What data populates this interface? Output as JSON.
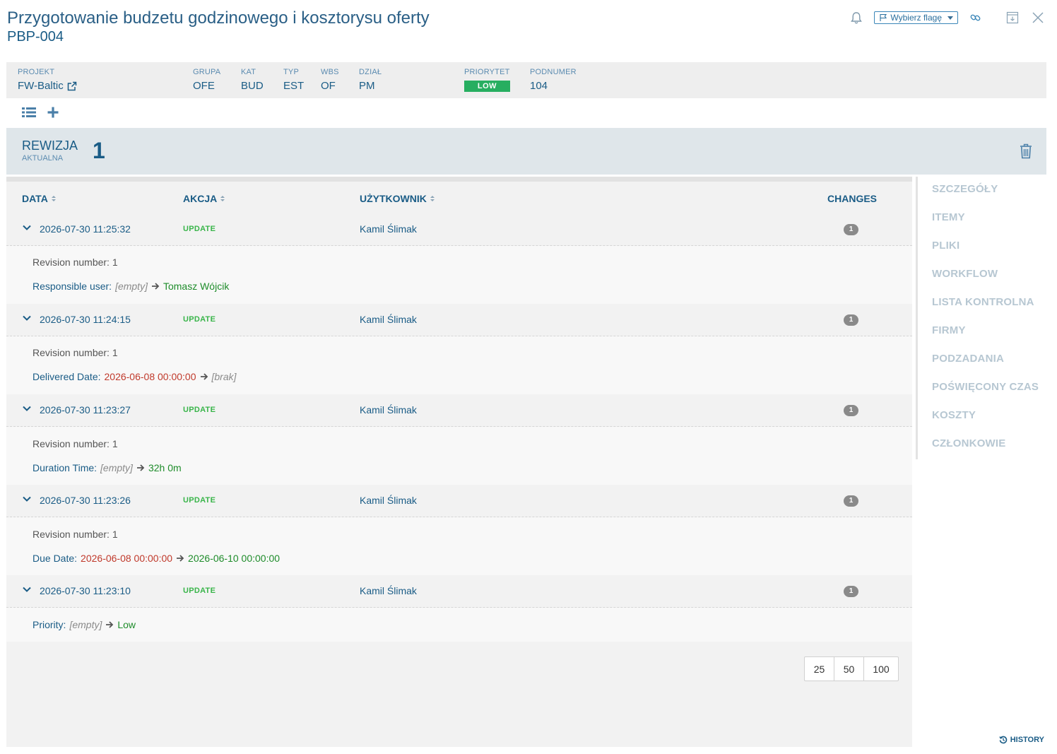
{
  "header": {
    "title": "Przygotowanie budzetu godzinowego i kosztorysu oferty",
    "code": "PBP-004",
    "flag_select": "Wybierz flagę",
    "icons": [
      "bell-icon",
      "flag-icon",
      "link-icon",
      "archive-icon",
      "close-icon"
    ]
  },
  "meta": {
    "project": {
      "label": "PROJEKT",
      "value": "FW-Baltic"
    },
    "group": {
      "label": "GRUPA",
      "value": "OFE"
    },
    "kat": {
      "label": "KAT",
      "value": "BUD"
    },
    "typ": {
      "label": "TYP",
      "value": "EST"
    },
    "wbs": {
      "label": "WBS",
      "value": "OF"
    },
    "dzial": {
      "label": "DZIAŁ",
      "value": "PM"
    },
    "priority": {
      "label": "PRIORYTET",
      "value": "LOW",
      "color": "#27ae60"
    },
    "subnumber": {
      "label": "PODNUMER",
      "value": "104"
    }
  },
  "revision": {
    "label": "REWIZJA",
    "sub": "AKTUALNA",
    "number": "1"
  },
  "table": {
    "columns": {
      "date": "DATA",
      "action": "AKCJA",
      "user": "UŻYTKOWNIK",
      "changes": "CHANGES"
    },
    "entries": [
      {
        "date": "2026-07-30 11:25:32",
        "action": "UPDATE",
        "user": "Kamil Ślimak",
        "changes": "1",
        "revision_line": "Revision number: 1",
        "field": "Responsible user:",
        "old": "[empty]",
        "new": "Tomasz Wójcik"
      },
      {
        "date": "2026-07-30 11:24:15",
        "action": "UPDATE",
        "user": "Kamil Ślimak",
        "changes": "1",
        "revision_line": "Revision number: 1",
        "field": "Delivered Date:",
        "old": "2026-06-08 00:00:00",
        "new": "[brak]"
      },
      {
        "date": "2026-07-30 11:23:27",
        "action": "UPDATE",
        "user": "Kamil Ślimak",
        "changes": "1",
        "revision_line": "Revision number: 1",
        "field": "Duration Time:",
        "old": "[empty]",
        "new": "32h 0m"
      },
      {
        "date": "2026-07-30 11:23:26",
        "action": "UPDATE",
        "user": "Kamil Ślimak",
        "changes": "1",
        "revision_line": "Revision number: 1",
        "field": "Due Date:",
        "old": "2026-06-08 00:00:00",
        "new": "2026-06-10 00:00:00"
      },
      {
        "date": "2026-07-30 11:23:10",
        "action": "UPDATE",
        "user": "Kamil Ślimak",
        "changes": "1",
        "field": "Priority:",
        "old": "[empty]",
        "new": "Low"
      }
    ]
  },
  "pagination": [
    "25",
    "50",
    "100"
  ],
  "side_nav": [
    "SZCZEGÓŁY",
    "ITEMY",
    "PLIKI",
    "WORKFLOW",
    "LISTA KONTROLNA",
    "FIRMY",
    "PODZADANIA",
    "POŚWIĘCONY CZAS",
    "KOSZTY",
    "CZŁONKOWIE"
  ],
  "footer": {
    "history_label": "HISTORY"
  }
}
